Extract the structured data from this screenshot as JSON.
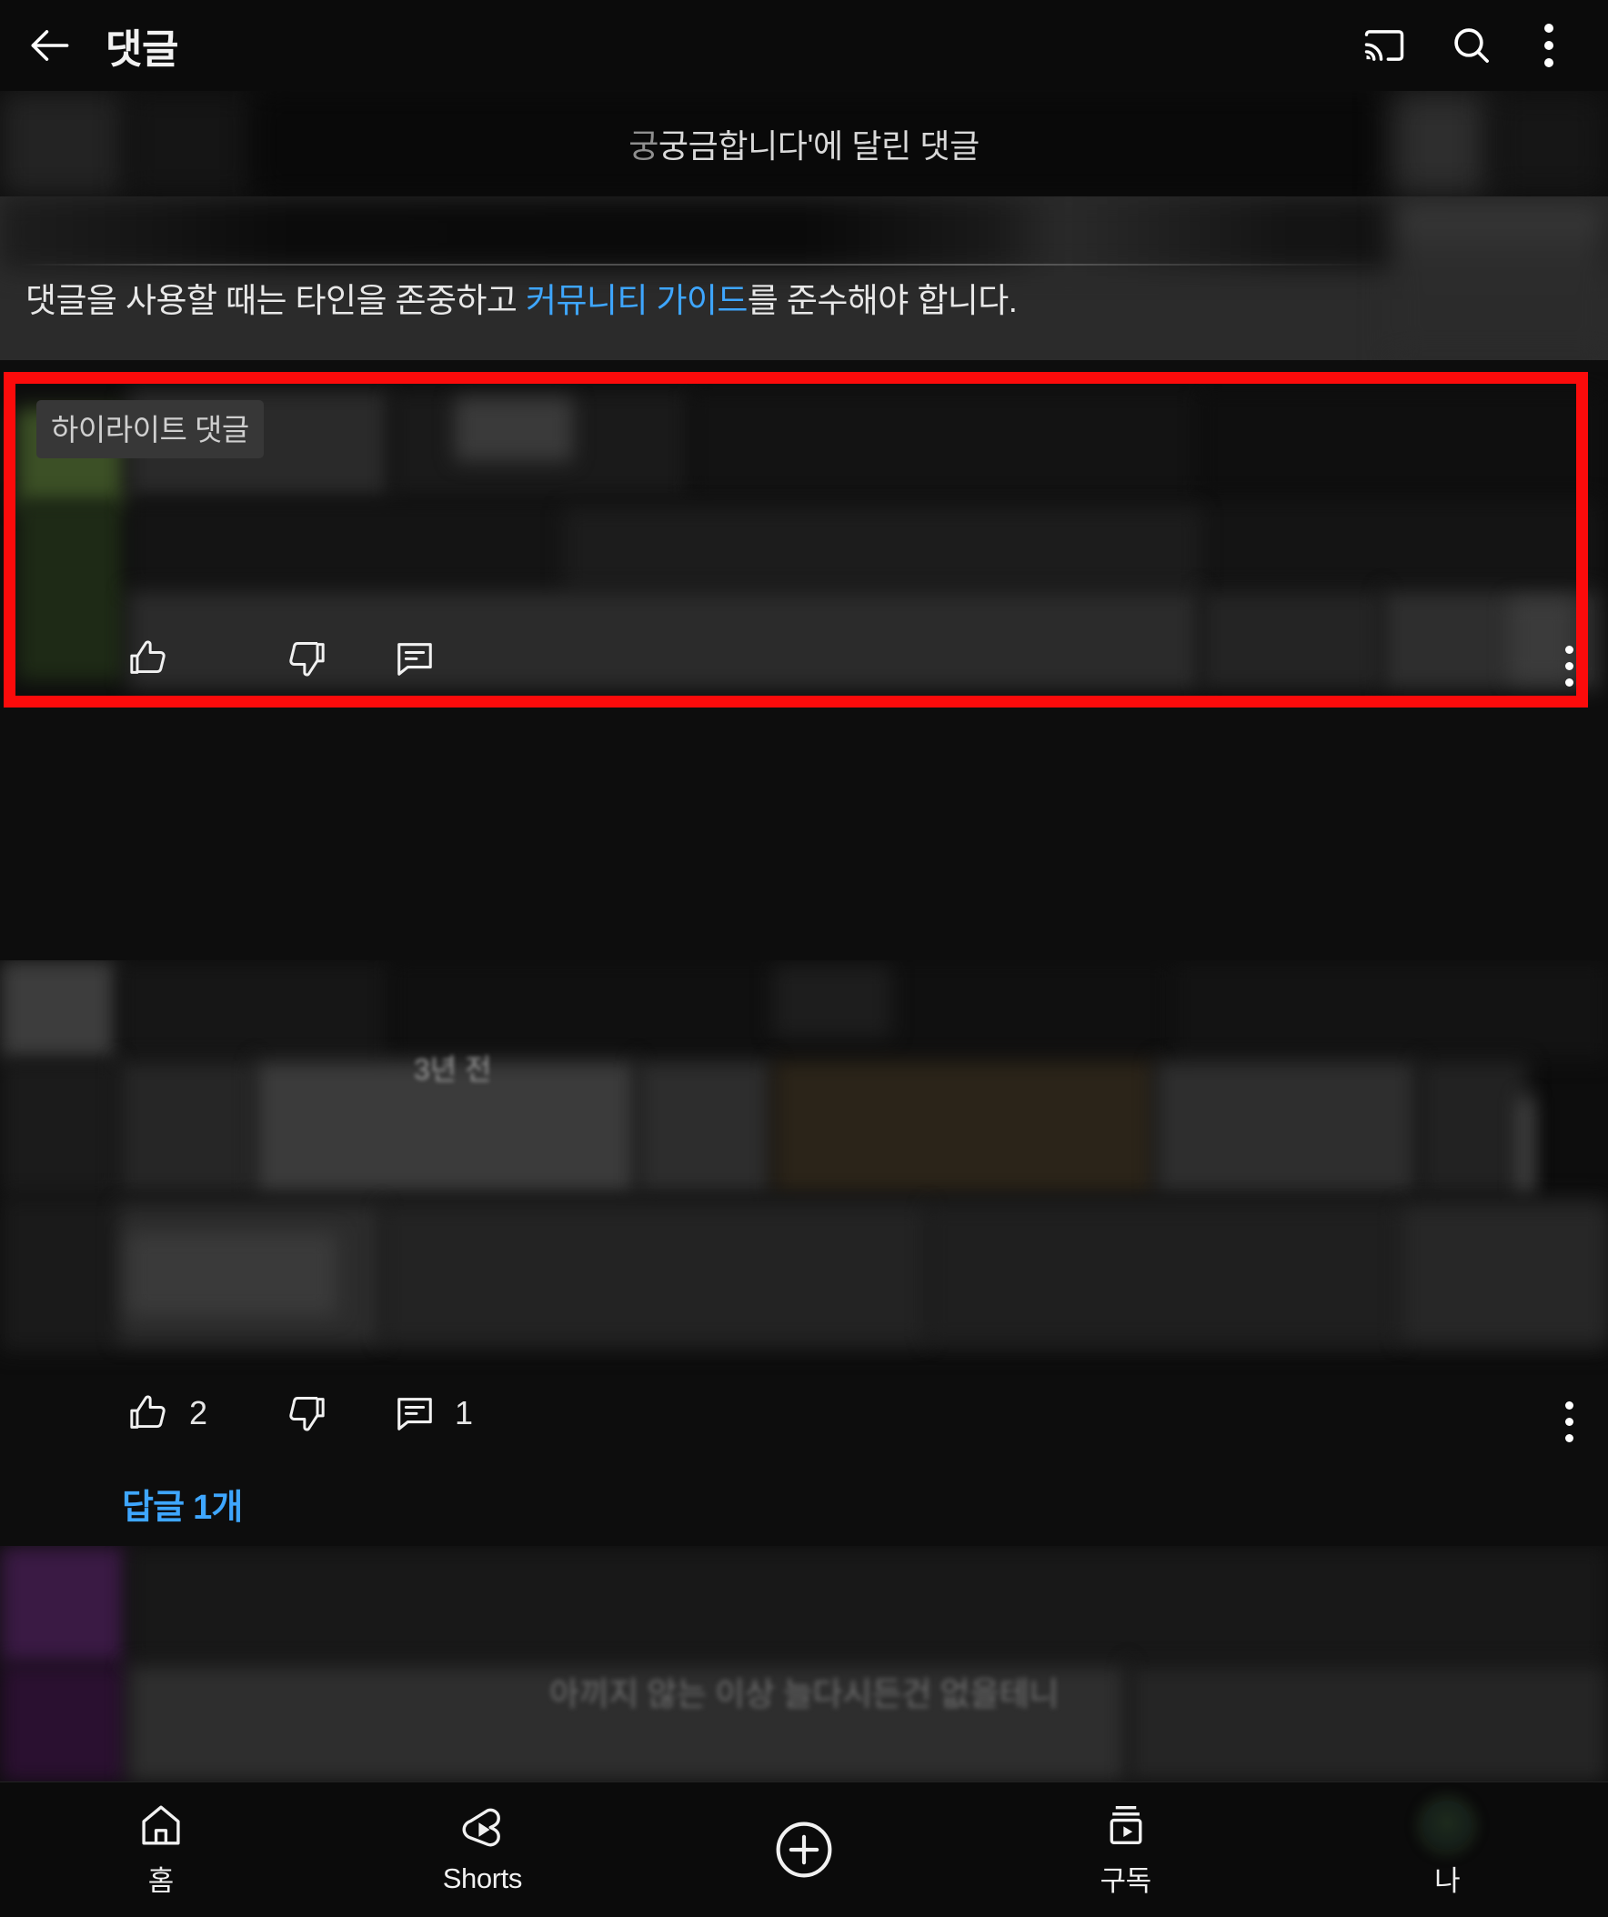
{
  "header": {
    "back_icon": "arrow-left-icon",
    "title": "댓글",
    "cast_icon": "cast-icon",
    "search_icon": "search-icon",
    "overflow_icon": "more-vertical-icon"
  },
  "video": {
    "comments_on_label": "궁금합니다'에 달린 댓글",
    "masked_prefix": "궁"
  },
  "guideline": {
    "prefix": "댓글을 사용할 때는 타인을 존중하고 ",
    "link": "커뮤니티 가이드",
    "suffix": "를 준수해야 합니다."
  },
  "highlight": {
    "badge": "하이라이트 댓글",
    "border_color": "#fb0b0b"
  },
  "comments": [
    {
      "id": "comment-highlighted",
      "highlighted": true,
      "author": "",
      "timestamp": "",
      "body": "",
      "like_icon": "thumbs-up-icon",
      "like_count": "",
      "dislike_icon": "thumbs-down-icon",
      "reply_icon": "comment-reply-icon",
      "reply_count": "",
      "overflow_icon": "more-vertical-icon"
    },
    {
      "id": "comment-second",
      "highlighted": false,
      "author": "",
      "timestamp": "3년 전",
      "body": "",
      "like_icon": "thumbs-up-icon",
      "like_count": "2",
      "dislike_icon": "thumbs-down-icon",
      "reply_icon": "comment-reply-icon",
      "reply_count": "1",
      "overflow_icon": "more-vertical-icon",
      "replies_label": "답글 1개"
    }
  ],
  "bleed": {
    "line1": "아끼지 않는 이상 늘다시든건 없을테니"
  },
  "bottom_nav": {
    "items": [
      {
        "icon": "home-icon",
        "label": "홈"
      },
      {
        "icon": "shorts-icon",
        "label": "Shorts"
      },
      {
        "icon": "plus-circle-icon",
        "label": ""
      },
      {
        "icon": "subscriptions-icon",
        "label": "구독"
      },
      {
        "icon": "account-avatar-icon",
        "label": "나"
      }
    ]
  },
  "colors": {
    "accent_link": "#3ea6ff",
    "highlight_red": "#fb0b0b",
    "background": "#0d0d0d",
    "guideline_bg": "#2b2b2b"
  }
}
